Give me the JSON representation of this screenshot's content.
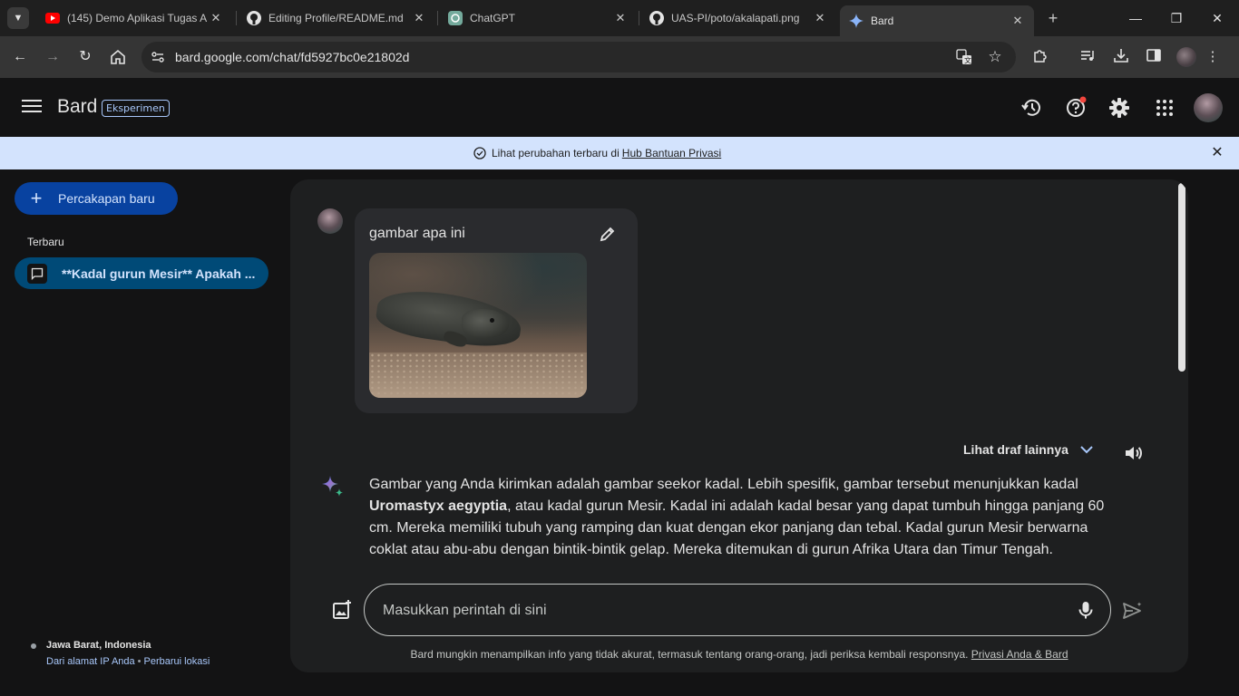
{
  "browser": {
    "tabs": [
      {
        "title": "(145) Demo Aplikasi Tugas A",
        "icon": "youtube-icon",
        "active": false
      },
      {
        "title": "Editing Profile/README.md",
        "icon": "github-icon",
        "active": false
      },
      {
        "title": "ChatGPT",
        "icon": "chatgpt-icon",
        "active": false
      },
      {
        "title": "UAS-PI/poto/akalapati.png",
        "icon": "github-icon",
        "active": false
      },
      {
        "title": "Bard",
        "icon": "bard-icon",
        "active": true
      }
    ],
    "url": "bard.google.com/chat/fd5927bc0e21802d"
  },
  "header": {
    "title": "Bard",
    "badge": "Eksperimen"
  },
  "banner": {
    "text": "Lihat perubahan terbaru di",
    "link": "Hub Bantuan Privasi"
  },
  "sidebar": {
    "new_chat_label": "Percakapan baru",
    "recent_label": "Terbaru",
    "recent_items": [
      {
        "label": "**Kadal gurun Mesir** Apakah ..."
      }
    ],
    "location": {
      "place": "Jawa Barat, Indonesia",
      "source": "Dari alamat IP Anda",
      "separator": "•",
      "update": "Perbarui lokasi"
    }
  },
  "chat": {
    "user_prompt": "gambar apa ini",
    "drafts_label": "Lihat draf lainnya",
    "answer": {
      "part1": "Gambar yang Anda kirimkan adalah gambar seekor kadal. Lebih spesifik, gambar tersebut menunjukkan kadal ",
      "bold": "Uromastyx aegyptia",
      "part2": ", atau kadal gurun Mesir. Kadal ini adalah kadal besar yang dapat tumbuh hingga panjang 60 cm. Mereka memiliki tubuh yang ramping dan kuat dengan ekor panjang dan tebal. Kadal gurun Mesir berwarna coklat atau abu-abu dengan bintik-bintik gelap. Mereka ditemukan di gurun Afrika Utara dan Timur Tengah."
    },
    "input_placeholder": "Masukkan perintah di sini",
    "disclaimer": "Bard mungkin menampilkan info yang tidak akurat, termasuk tentang orang-orang, jadi periksa kembali responsnya.",
    "disclaimer_link": "Privasi Anda & Bard"
  },
  "colors": {
    "accent": "#a8c7fa",
    "new_chat_bg": "#0842a0",
    "active_item_bg": "#004a77",
    "banner_bg": "#d3e3fd"
  }
}
